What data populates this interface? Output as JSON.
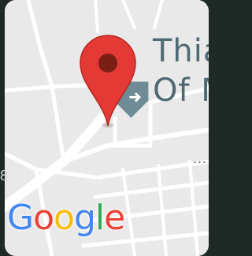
{
  "map": {
    "place_label": "Thia\nOf M",
    "more_indicator": "...",
    "attribution": {
      "letters": [
        "G",
        "o",
        "o",
        "g",
        "l",
        "e"
      ]
    },
    "pin": {
      "icon": "map-pin-icon",
      "color": "#e53935",
      "dot_color": "#7b1e16"
    },
    "poi_marker": {
      "icon": "tourist-attraction-icon",
      "color": "#6f8b96"
    },
    "colors": {
      "land": "#e9e9e9",
      "road": "#ffffff",
      "label": "#4f6a73"
    }
  }
}
